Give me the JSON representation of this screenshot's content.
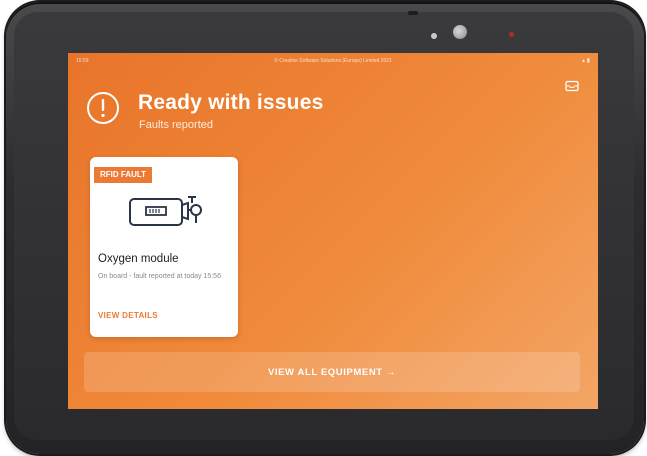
{
  "status_bar": {
    "time": "15:59",
    "copyright": "© Creative Software Solutions (Europe) Limited 2021",
    "icons": "▴ ▮"
  },
  "header": {
    "title": "Ready with issues",
    "subtitle": "Faults reported",
    "alert_icon": "exclamation-circle",
    "mail_icon": "envelope"
  },
  "card": {
    "badge": "RFID FAULT",
    "title": "Oxygen module",
    "description": "On board - fault reported at today 15:56",
    "link": "VIEW DETAILS",
    "icon": "oxygen-cylinder"
  },
  "footer_button": {
    "label": "VIEW ALL EQUIPMENT →"
  },
  "colors": {
    "accent": "#ec7a34",
    "screen_bg": "#f08a3a",
    "card_bg": "#ffffff"
  }
}
